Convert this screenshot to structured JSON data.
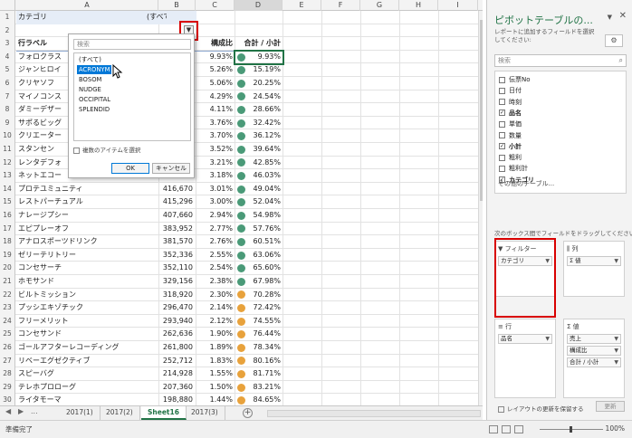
{
  "sheet": {
    "columns": [
      "A",
      "B",
      "C",
      "D",
      "E",
      "F",
      "G",
      "H",
      "I"
    ],
    "row_numbers": [
      "1",
      "2",
      "3",
      "4",
      "5",
      "6",
      "7",
      "8",
      "9",
      "10",
      "11",
      "12",
      "13",
      "14",
      "15",
      "16",
      "17",
      "18",
      "19",
      "20",
      "21",
      "22",
      "23",
      "24",
      "25",
      "26",
      "27",
      "28",
      "29",
      "30"
    ],
    "filter_label": "カテゴリ",
    "filter_value": "(すべて)",
    "filter_dropdown_glyph": "▼",
    "header": {
      "row_label": "行ラベル",
      "ratio": "構成比",
      "cumulative": "合計 / 小計"
    },
    "rows": [
      {
        "name": "フォロクラス",
        "value": "",
        "ratio": "9.93%",
        "cum": "9.93%",
        "color": "#4a9a78"
      },
      {
        "name": "ジャンヒロイ",
        "value": "",
        "ratio": "5.26%",
        "cum": "15.19%",
        "color": "#4a9a78"
      },
      {
        "name": "クリヤソフ",
        "value": "",
        "ratio": "5.06%",
        "cum": "20.25%",
        "color": "#4a9a78"
      },
      {
        "name": "マイノコンス",
        "value": "",
        "ratio": "4.29%",
        "cum": "24.54%",
        "color": "#4a9a78"
      },
      {
        "name": "ダミーデザー",
        "value": "",
        "ratio": "4.11%",
        "cum": "28.66%",
        "color": "#4a9a78"
      },
      {
        "name": "サポるビッグ",
        "value": "",
        "ratio": "3.76%",
        "cum": "32.42%",
        "color": "#4a9a78"
      },
      {
        "name": "クリエーター",
        "value": "",
        "ratio": "3.70%",
        "cum": "36.12%",
        "color": "#4a9a78"
      },
      {
        "name": "スタンセン",
        "value": "",
        "ratio": "3.52%",
        "cum": "39.64%",
        "color": "#4a9a78"
      },
      {
        "name": "レンタデフォ",
        "value": "",
        "ratio": "3.21%",
        "cum": "42.85%",
        "color": "#4a9a78"
      },
      {
        "name": "ネットエコー",
        "value": "440,158",
        "ratio": "3.18%",
        "cum": "46.03%",
        "color": "#4a9a78"
      },
      {
        "name": "プロテユミュニティ",
        "value": "416,670",
        "ratio": "3.01%",
        "cum": "49.04%",
        "color": "#4a9a78"
      },
      {
        "name": "レストパーチュアル",
        "value": "415,296",
        "ratio": "3.00%",
        "cum": "52.04%",
        "color": "#4a9a78"
      },
      {
        "name": "ナレージプシー",
        "value": "407,660",
        "ratio": "2.94%",
        "cum": "54.98%",
        "color": "#4a9a78"
      },
      {
        "name": "エピプレーオフ",
        "value": "383,952",
        "ratio": "2.77%",
        "cum": "57.76%",
        "color": "#4a9a78"
      },
      {
        "name": "アナロスポーツドリンク",
        "value": "381,570",
        "ratio": "2.76%",
        "cum": "60.51%",
        "color": "#4a9a78"
      },
      {
        "name": "ゼリーテリトリー",
        "value": "352,336",
        "ratio": "2.55%",
        "cum": "63.06%",
        "color": "#4a9a78"
      },
      {
        "name": "コンセサーチ",
        "value": "352,110",
        "ratio": "2.54%",
        "cum": "65.60%",
        "color": "#4a9a78"
      },
      {
        "name": "ホモサンド",
        "value": "329,156",
        "ratio": "2.38%",
        "cum": "67.98%",
        "color": "#4a9a78"
      },
      {
        "name": "ビルトミッション",
        "value": "318,920",
        "ratio": "2.30%",
        "cum": "70.28%",
        "color": "#e8a23c"
      },
      {
        "name": "プッシエキゾチック",
        "value": "296,470",
        "ratio": "2.14%",
        "cum": "72.42%",
        "color": "#e8a23c"
      },
      {
        "name": "フリーメリット",
        "value": "293,940",
        "ratio": "2.12%",
        "cum": "74.55%",
        "color": "#e8a23c"
      },
      {
        "name": "コンセサンド",
        "value": "262,636",
        "ratio": "1.90%",
        "cum": "76.44%",
        "color": "#e8a23c"
      },
      {
        "name": "ゴールアフターレコーディング",
        "value": "261,800",
        "ratio": "1.89%",
        "cum": "78.34%",
        "color": "#e8a23c"
      },
      {
        "name": "リベーエグゼクティブ",
        "value": "252,712",
        "ratio": "1.83%",
        "cum": "80.16%",
        "color": "#e8a23c"
      },
      {
        "name": "スピーバグ",
        "value": "214,928",
        "ratio": "1.55%",
        "cum": "81.71%",
        "color": "#e8a23c"
      },
      {
        "name": "テレホプロローグ",
        "value": "207,360",
        "ratio": "1.50%",
        "cum": "83.21%",
        "color": "#e8a23c"
      },
      {
        "name": "ライタモーマ",
        "value": "198,880",
        "ratio": "1.44%",
        "cum": "84.65%",
        "color": "#e8a23c"
      }
    ]
  },
  "popup": {
    "search_placeholder": "検索",
    "items": [
      "(すべて)",
      "ACRONYM",
      "BOSOM",
      "NUDGE",
      "OCCIPITAL",
      "SPLENDID"
    ],
    "highlighted_index": 1,
    "multi_select": "複数のアイテムを選択",
    "ok": "OK",
    "cancel": "キャンセル"
  },
  "tabs": {
    "nav_ellipsis": "...",
    "items": [
      "2017(1)",
      "2017(2)",
      "Sheet16",
      "2017(3)"
    ],
    "active_index": 2,
    "add": "+"
  },
  "status": {
    "ready": "準備完了",
    "zoom": "100%"
  },
  "pane": {
    "title": "ピボットテーブルの...",
    "hint": "レポートに追加するフィールドを選択してください:",
    "search_placeholder": "検索",
    "fields": [
      {
        "label": "伝票No",
        "checked": false
      },
      {
        "label": "日付",
        "checked": false
      },
      {
        "label": "時刻",
        "checked": false
      },
      {
        "label": "品名",
        "checked": true
      },
      {
        "label": "単価",
        "checked": false
      },
      {
        "label": "数量",
        "checked": false
      },
      {
        "label": "小計",
        "checked": true
      },
      {
        "label": "粗利",
        "checked": false
      },
      {
        "label": "粗利計",
        "checked": false
      },
      {
        "label": "カテゴリ",
        "checked": true
      }
    ],
    "more_tables": "その他のテーブル...",
    "drag_hint": "次のボックス間でフィールドをドラッグしてください:",
    "areas": {
      "filter": {
        "title": "フィルター",
        "items": [
          "カテゴリ"
        ]
      },
      "columns": {
        "title": "列",
        "items": [
          "Σ 値"
        ]
      },
      "rows": {
        "title": "行",
        "items": [
          "品名"
        ]
      },
      "values": {
        "title": "Σ 値",
        "items": [
          "売上",
          "構成比",
          "合計 / 小計"
        ]
      }
    },
    "defer_label": "レイアウトの更新を保留する",
    "update_button": "更新"
  },
  "colors": {
    "accent": "#217346",
    "highlight_box": "#d80000",
    "selection": "#0078d7"
  }
}
